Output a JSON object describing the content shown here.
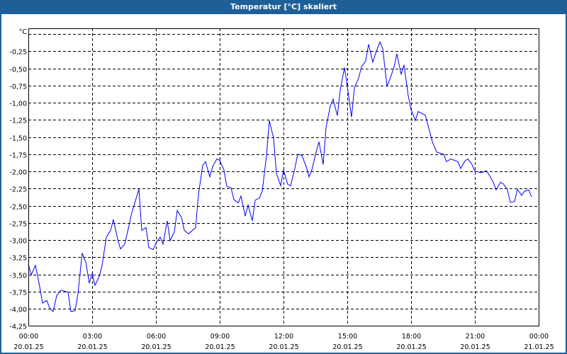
{
  "window": {
    "title": "Temperatur [°C] skaliert"
  },
  "colors": {
    "titlebar": "#1f5f97",
    "line": "#0000ff",
    "grid": "#000000"
  },
  "chart_data": {
    "type": "line",
    "title": "Temperatur [°C] skaliert",
    "ylabel": "°C",
    "xlabel": "",
    "ylim": [
      -4.25,
      0.08
    ],
    "xlim_minutes": [
      0,
      1440
    ],
    "grid": true,
    "yticks": [
      {
        "value": -0.25,
        "label": "-0,25"
      },
      {
        "value": -0.5,
        "label": "-0,50"
      },
      {
        "value": -0.75,
        "label": "-0,75"
      },
      {
        "value": -1.0,
        "label": "-1,00"
      },
      {
        "value": -1.25,
        "label": "-1,25"
      },
      {
        "value": -1.5,
        "label": "-1,50"
      },
      {
        "value": -1.75,
        "label": "-1,75"
      },
      {
        "value": -2.0,
        "label": "-2,00"
      },
      {
        "value": -2.25,
        "label": "-2,25"
      },
      {
        "value": -2.5,
        "label": "-2,50"
      },
      {
        "value": -2.75,
        "label": "-2,75"
      },
      {
        "value": -3.0,
        "label": "-3,00"
      },
      {
        "value": -3.25,
        "label": "-3,25"
      },
      {
        "value": -3.5,
        "label": "-3,50"
      },
      {
        "value": -3.75,
        "label": "-3,75"
      },
      {
        "value": -4.0,
        "label": "-4,00"
      },
      {
        "value": -4.25,
        "label": "-4,25"
      }
    ],
    "xticks": [
      {
        "minutes": 0,
        "time": "00:00",
        "date": "20.01.25"
      },
      {
        "minutes": 180,
        "time": "03:00",
        "date": "20.01.25"
      },
      {
        "minutes": 360,
        "time": "06:00",
        "date": "20.01.25"
      },
      {
        "minutes": 540,
        "time": "09:00",
        "date": "20.01.25"
      },
      {
        "minutes": 720,
        "time": "12:00",
        "date": "20.01.25"
      },
      {
        "minutes": 900,
        "time": "15:00",
        "date": "20.01.25"
      },
      {
        "minutes": 1080,
        "time": "18:00",
        "date": "20.01.25"
      },
      {
        "minutes": 1260,
        "time": "21:00",
        "date": "20.01.25"
      },
      {
        "minutes": 1440,
        "time": "00:00",
        "date": "21.01.25"
      }
    ],
    "series": [
      {
        "name": "Temperatur",
        "points_minutes_value": [
          [
            0,
            -3.35
          ],
          [
            8,
            -3.51
          ],
          [
            20,
            -3.37
          ],
          [
            32,
            -3.68
          ],
          [
            40,
            -3.92
          ],
          [
            52,
            -3.88
          ],
          [
            60,
            -3.99
          ],
          [
            70,
            -4.04
          ],
          [
            80,
            -3.81
          ],
          [
            92,
            -3.73
          ],
          [
            112,
            -3.76
          ],
          [
            120,
            -4.04
          ],
          [
            132,
            -4.03
          ],
          [
            140,
            -3.78
          ],
          [
            152,
            -3.19
          ],
          [
            162,
            -3.32
          ],
          [
            172,
            -3.63
          ],
          [
            180,
            -3.49
          ],
          [
            188,
            -3.66
          ],
          [
            200,
            -3.53
          ],
          [
            208,
            -3.37
          ],
          [
            220,
            -2.96
          ],
          [
            232,
            -2.86
          ],
          [
            240,
            -2.7
          ],
          [
            252,
            -2.99
          ],
          [
            260,
            -3.13
          ],
          [
            272,
            -3.06
          ],
          [
            280,
            -2.88
          ],
          [
            292,
            -2.6
          ],
          [
            312,
            -2.26
          ],
          [
            320,
            -2.86
          ],
          [
            332,
            -2.82
          ],
          [
            340,
            -3.11
          ],
          [
            352,
            -3.14
          ],
          [
            364,
            -3.01
          ],
          [
            372,
            -2.96
          ],
          [
            380,
            -3.06
          ],
          [
            392,
            -2.72
          ],
          [
            400,
            -3.01
          ],
          [
            412,
            -2.88
          ],
          [
            420,
            -2.57
          ],
          [
            432,
            -2.67
          ],
          [
            440,
            -2.86
          ],
          [
            452,
            -2.91
          ],
          [
            472,
            -2.82
          ],
          [
            480,
            -2.34
          ],
          [
            492,
            -1.91
          ],
          [
            500,
            -1.86
          ],
          [
            512,
            -2.08
          ],
          [
            520,
            -1.93
          ],
          [
            532,
            -1.82
          ],
          [
            540,
            -1.84
          ],
          [
            552,
            -1.98
          ],
          [
            560,
            -2.22
          ],
          [
            572,
            -2.24
          ],
          [
            580,
            -2.41
          ],
          [
            592,
            -2.46
          ],
          [
            600,
            -2.36
          ],
          [
            612,
            -2.65
          ],
          [
            620,
            -2.49
          ],
          [
            632,
            -2.72
          ],
          [
            640,
            -2.42
          ],
          [
            652,
            -2.39
          ],
          [
            660,
            -2.29
          ],
          [
            672,
            -1.77
          ],
          [
            680,
            -1.26
          ],
          [
            692,
            -1.52
          ],
          [
            700,
            -2.03
          ],
          [
            712,
            -2.21
          ],
          [
            720,
            -1.98
          ],
          [
            732,
            -2.19
          ],
          [
            740,
            -2.21
          ],
          [
            752,
            -1.96
          ],
          [
            760,
            -1.75
          ],
          [
            772,
            -1.77
          ],
          [
            784,
            -1.93
          ],
          [
            792,
            -2.08
          ],
          [
            800,
            -1.98
          ],
          [
            812,
            -1.72
          ],
          [
            820,
            -1.57
          ],
          [
            832,
            -1.9
          ],
          [
            840,
            -1.36
          ],
          [
            852,
            -1.05
          ],
          [
            860,
            -0.95
          ],
          [
            872,
            -1.19
          ],
          [
            880,
            -0.82
          ],
          [
            892,
            -0.49
          ],
          [
            900,
            -0.76
          ],
          [
            912,
            -1.21
          ],
          [
            920,
            -0.79
          ],
          [
            932,
            -0.64
          ],
          [
            940,
            -0.48
          ],
          [
            952,
            -0.39
          ],
          [
            960,
            -0.15
          ],
          [
            972,
            -0.41
          ],
          [
            980,
            -0.28
          ],
          [
            992,
            -0.12
          ],
          [
            1000,
            -0.21
          ],
          [
            1012,
            -0.76
          ],
          [
            1020,
            -0.66
          ],
          [
            1032,
            -0.48
          ],
          [
            1040,
            -0.29
          ],
          [
            1052,
            -0.59
          ],
          [
            1060,
            -0.45
          ],
          [
            1072,
            -0.9
          ],
          [
            1080,
            -1.1
          ],
          [
            1092,
            -1.26
          ],
          [
            1100,
            -1.13
          ],
          [
            1120,
            -1.18
          ],
          [
            1132,
            -1.41
          ],
          [
            1140,
            -1.57
          ],
          [
            1152,
            -1.72
          ],
          [
            1172,
            -1.75
          ],
          [
            1180,
            -1.86
          ],
          [
            1192,
            -1.82
          ],
          [
            1212,
            -1.86
          ],
          [
            1220,
            -1.96
          ],
          [
            1232,
            -1.85
          ],
          [
            1240,
            -1.82
          ],
          [
            1252,
            -1.9
          ],
          [
            1260,
            -2.0
          ],
          [
            1280,
            -2.02
          ],
          [
            1292,
            -1.99
          ],
          [
            1300,
            -2.05
          ],
          [
            1312,
            -2.16
          ],
          [
            1320,
            -2.27
          ],
          [
            1332,
            -2.16
          ],
          [
            1340,
            -2.18
          ],
          [
            1352,
            -2.27
          ],
          [
            1360,
            -2.45
          ],
          [
            1372,
            -2.44
          ],
          [
            1380,
            -2.26
          ],
          [
            1392,
            -2.35
          ],
          [
            1400,
            -2.29
          ],
          [
            1412,
            -2.27
          ],
          [
            1420,
            -2.37
          ]
        ]
      }
    ]
  }
}
